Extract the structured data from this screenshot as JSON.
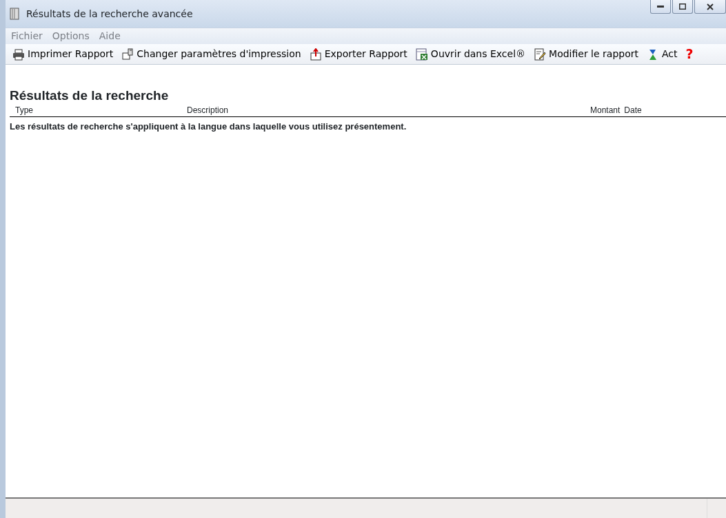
{
  "window": {
    "title": "Résultats de la recherche avancée"
  },
  "menu": [
    "Fichier",
    "Options",
    "Aide"
  ],
  "toolbar": [
    {
      "kind": "print",
      "label": "Imprimer Rapport"
    },
    {
      "kind": "settings",
      "label": "Changer paramètres d'impression"
    },
    {
      "kind": "export",
      "label": "Exporter Rapport"
    },
    {
      "kind": "excel",
      "label": "Ouvrir dans Excel®"
    },
    {
      "kind": "edit",
      "label": "Modifier le rapport"
    },
    {
      "kind": "act",
      "label": "Act"
    },
    {
      "kind": "help",
      "label": "?"
    }
  ],
  "report": {
    "title": "Résultats de la recherche",
    "columns": [
      "Type",
      "Description",
      "Montant",
      "Date"
    ],
    "message": "Les résultats de recherche s'appliquent à la langue dans laquelle vous utilisez présentement."
  }
}
